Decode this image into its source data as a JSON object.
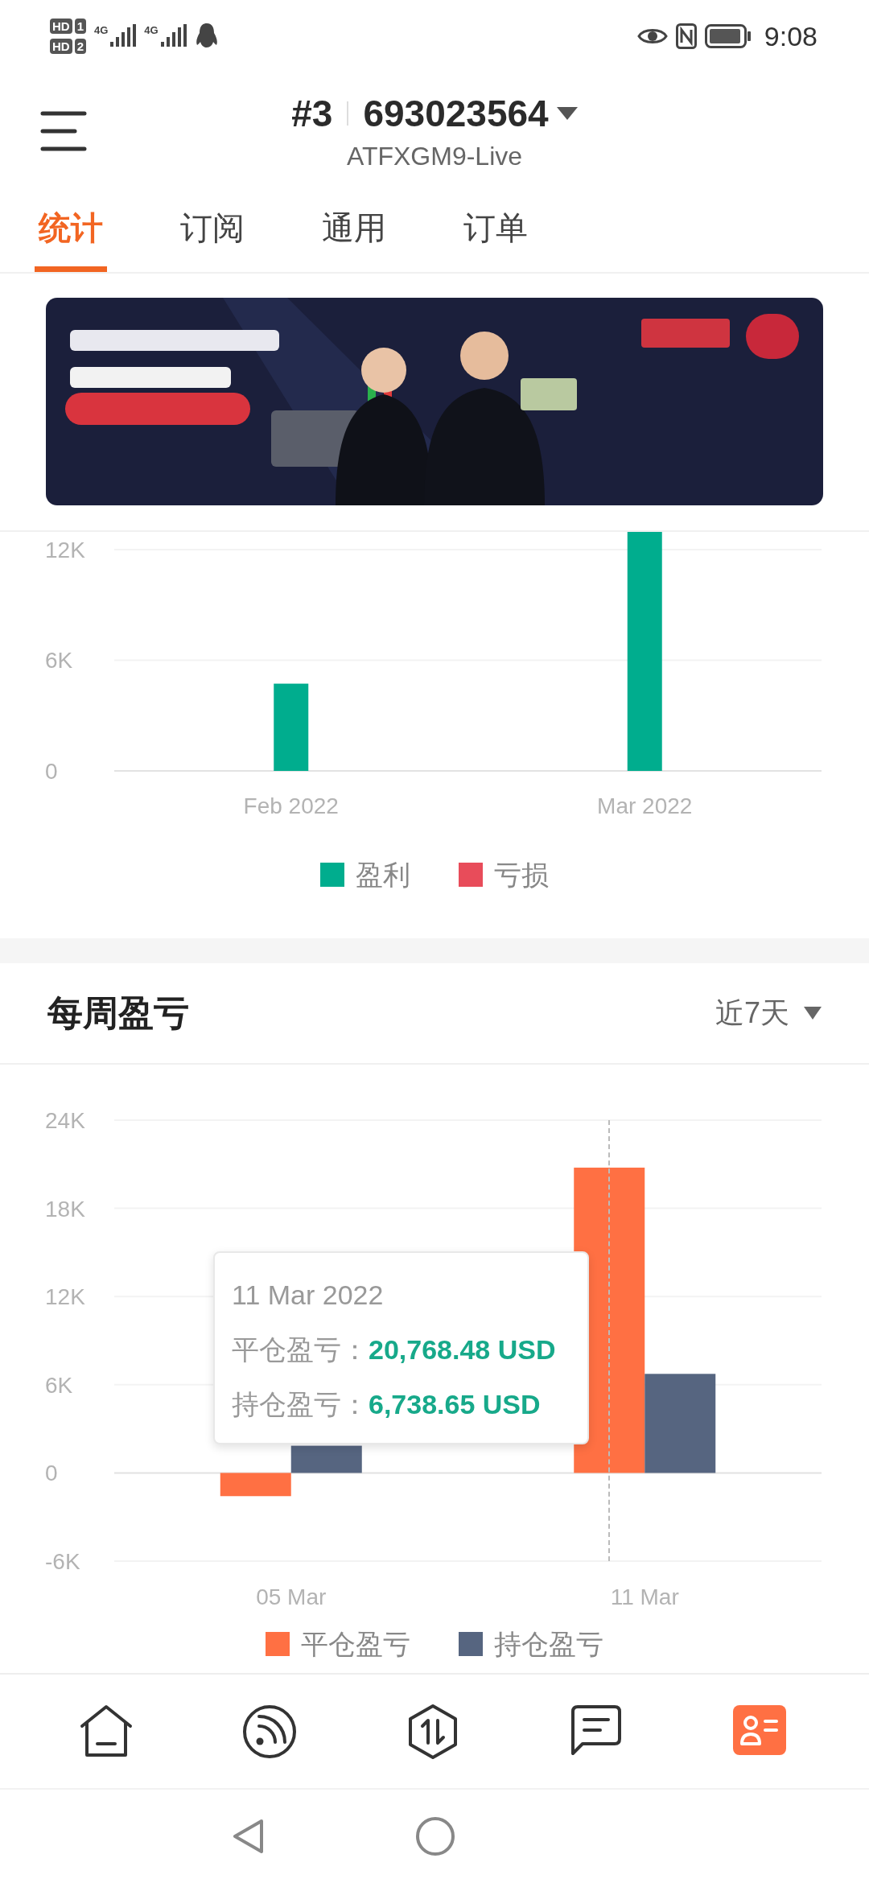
{
  "status_bar": {
    "sims": [
      {
        "label": "HD",
        "slot": "1"
      },
      {
        "label": "HD",
        "slot": "2"
      }
    ],
    "networks": [
      "4G",
      "4G"
    ],
    "time": "9:08"
  },
  "header": {
    "index": "#3",
    "account": "693023564",
    "server": "ATFXGM9-Live"
  },
  "tabs": [
    {
      "label": "统计",
      "selected": true
    },
    {
      "label": "订阅",
      "selected": false
    },
    {
      "label": "通用",
      "selected": false
    },
    {
      "label": "订单",
      "selected": false
    }
  ],
  "monthly": {
    "chart_data": {
      "type": "bar",
      "categories": [
        "Feb 2022",
        "Mar 2022"
      ],
      "series": [
        {
          "name": "盈利",
          "color": "#00ad8e",
          "values": [
            4730,
            13000
          ]
        },
        {
          "name": "亏损",
          "color": "#e84c5a",
          "values": [
            null,
            null
          ]
        }
      ],
      "ylim": [
        0,
        13000
      ],
      "yticks": [
        {
          "value": 0,
          "label": "0"
        },
        {
          "value": 6000,
          "label": "6K"
        },
        {
          "value": 12000,
          "label": "12K"
        }
      ],
      "grid": true,
      "legend": true
    }
  },
  "weekly": {
    "title": "每周盈亏",
    "period": "近7天",
    "chart_data": {
      "type": "bar",
      "categories": [
        "05 Mar",
        "11 Mar"
      ],
      "series": [
        {
          "name": "平仓盈亏",
          "color": "#ff7043",
          "values": [
            -1580,
            20768.48
          ]
        },
        {
          "name": "持仓盈亏",
          "color": "#566580",
          "values": [
            1850,
            6738.65
          ]
        }
      ],
      "ylim": [
        -6000,
        24000
      ],
      "yticks": [
        {
          "value": -6000,
          "label": "-6K"
        },
        {
          "value": 0,
          "label": "0"
        },
        {
          "value": 6000,
          "label": "6K"
        },
        {
          "value": 12000,
          "label": "12K"
        },
        {
          "value": 18000,
          "label": "18K"
        },
        {
          "value": 24000,
          "label": "24K"
        }
      ],
      "grid": true,
      "legend": true,
      "ref_lines": [
        {
          "axis": "x",
          "value": "11 Mar"
        }
      ]
    },
    "tooltip": {
      "title": "11 Mar 2022",
      "rows": [
        {
          "label": "平仓盈亏：",
          "value": "20,768.48 USD"
        },
        {
          "label": "持仓盈亏：",
          "value": "6,738.65 USD"
        }
      ]
    }
  },
  "bottom_nav": [
    {
      "selected": false
    },
    {
      "selected": false
    },
    {
      "selected": false
    },
    {
      "selected": false
    },
    {
      "selected": true
    }
  ]
}
